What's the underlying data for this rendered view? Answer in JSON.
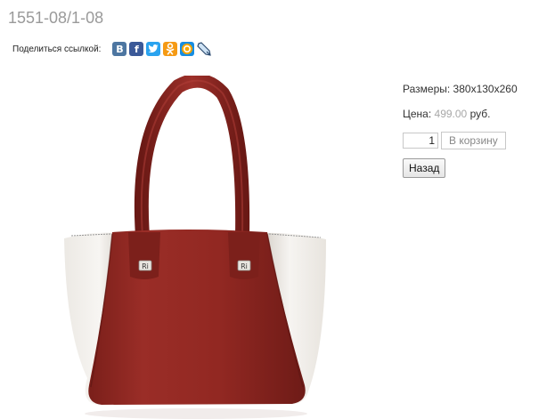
{
  "product": {
    "code": "1551-08/1-08",
    "image_alt": "handbag"
  },
  "share": {
    "label": "Поделиться ссылкой:",
    "icons": [
      {
        "name": "vkontakte-icon",
        "glyph": "B",
        "color": "#4d76a1"
      },
      {
        "name": "facebook-icon",
        "glyph": "f",
        "color": "#3b5998"
      },
      {
        "name": "twitter-icon",
        "glyph": "t",
        "color": "#2aa3ef"
      },
      {
        "name": "odnoklassniki-icon",
        "glyph": "ok",
        "color": "#f59a14"
      },
      {
        "name": "mailru-icon",
        "glyph": "@",
        "color": "#168de2"
      },
      {
        "name": "livejournal-icon",
        "glyph": "pencil",
        "color": "#2b4a6f"
      }
    ]
  },
  "details": {
    "size_label": "Размеры:",
    "size_value": "380х130х260",
    "price_label": "Цена:",
    "price_value": "499.00",
    "price_currency": "руб."
  },
  "cart": {
    "quantity": "1",
    "add_label": "В корзину"
  },
  "nav": {
    "back_label": "Назад"
  }
}
